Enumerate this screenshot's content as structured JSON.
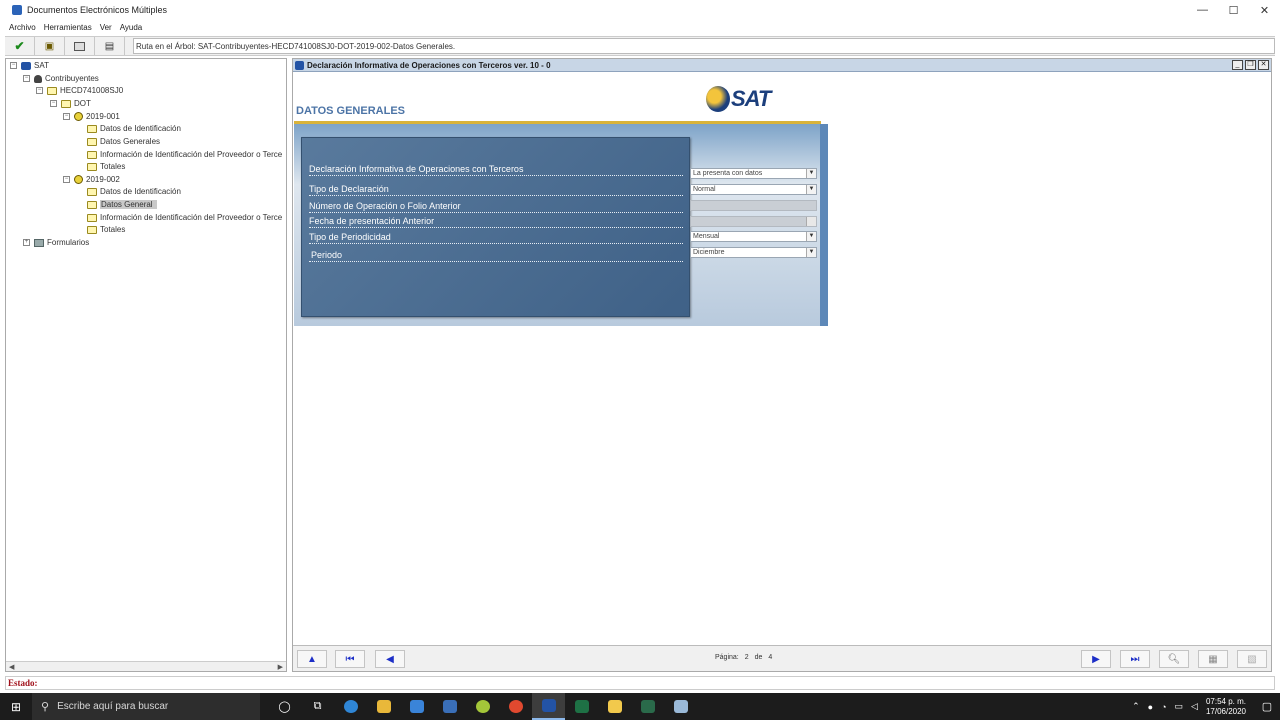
{
  "window": {
    "title": "Documentos Electrónicos Múltiples"
  },
  "menu": [
    "Archivo",
    "Herramientas",
    "Ver",
    "Ayuda"
  ],
  "toolbar": {
    "ruta": "Ruta en el Árbol: SAT-Contribuyentes-HECD741008SJ0-DOT-2019-002-Datos Generales."
  },
  "tree": {
    "root": "SAT",
    "contribuyentes": "Contribuyentes",
    "rfc": "HECD741008SJ0",
    "dot": "DOT",
    "period1": {
      "label": "2019-001",
      "items": [
        "Datos de Identificación",
        "Datos Generales",
        "Información de Identificación del Proveedor o Terce",
        "Totales"
      ]
    },
    "period2": {
      "label": "2019-002",
      "items": [
        "Datos de Identificación",
        "Datos General",
        "Información de Identificación del Proveedor o Terce",
        "Totales"
      ]
    },
    "formularios": "Formularios"
  },
  "inner": {
    "title": "Declaración Informativa de Operaciones con Terceros ver. 10 - 0",
    "heading": "DATOS GENERALES",
    "logo_text": "SAT",
    "fields": [
      {
        "label": "Declaración Informativa de Operaciones con Terceros",
        "value": "La presenta con datos"
      },
      {
        "label": "Tipo de Declaración",
        "value": "Normal"
      },
      {
        "label": "Número de Operación o Folio Anterior",
        "value": ""
      },
      {
        "label": "Fecha de presentación Anterior",
        "value": ""
      },
      {
        "label": "Tipo de Periodicidad",
        "value": "Mensual"
      },
      {
        "label": "Periodo",
        "value": "Diciembre"
      }
    ],
    "pagination": {
      "label": "Página:",
      "current": "2",
      "of": "de",
      "total": "4"
    }
  },
  "status": {
    "label": "Estado:"
  },
  "taskbar": {
    "search_placeholder": "Escribe aquí para buscar",
    "time": "07:54 p. m.",
    "date": "17/06/2020"
  }
}
